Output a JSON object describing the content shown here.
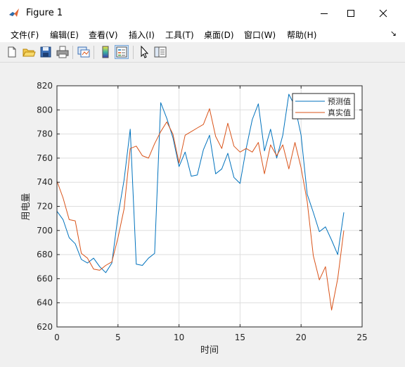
{
  "window": {
    "title": "Figure 1",
    "icon": "matlab-logo-icon",
    "controls": [
      "minimize-icon",
      "maximize-icon",
      "close-icon"
    ]
  },
  "menubar": {
    "items": [
      "文件(F)",
      "编辑(E)",
      "查看(V)",
      "插入(I)",
      "工具(T)",
      "桌面(D)",
      "窗口(W)",
      "帮助(H)"
    ],
    "dock_arrow": "↘"
  },
  "toolbar": {
    "buttons": [
      "new-figure-icon",
      "open-file-icon",
      "save-figure-icon",
      "print-figure-icon",
      "link-plot-icon",
      "insert-colorbar-icon",
      "insert-legend-icon",
      "edit-plot-icon",
      "property-inspector-icon"
    ]
  },
  "chart_data": {
    "type": "line",
    "title": "",
    "xlabel": "时间",
    "ylabel": "用电量",
    "xlim": [
      0,
      25
    ],
    "ylim": [
      620,
      820
    ],
    "xticks": [
      0,
      5,
      10,
      15,
      20,
      25
    ],
    "yticks": [
      620,
      640,
      660,
      680,
      700,
      720,
      740,
      760,
      780,
      800,
      820
    ],
    "grid": true,
    "legend_position": "top-right",
    "x": [
      0,
      0.5,
      1,
      1.5,
      2,
      2.5,
      3,
      3.5,
      4,
      4.5,
      5,
      5.5,
      6,
      6.5,
      7,
      7.5,
      8,
      8.5,
      9,
      9.5,
      10,
      10.5,
      11,
      11.5,
      12,
      12.5,
      13,
      13.5,
      14,
      14.5,
      15,
      15.5,
      16,
      16.5,
      17,
      17.5,
      18,
      18.5,
      19,
      19.5,
      20,
      20.5,
      21,
      21.5,
      22,
      22.5,
      23,
      23.5
    ],
    "series": [
      {
        "name": "预测值",
        "color": "#0072bd",
        "values": [
          716,
          709,
          694,
          689,
          676,
          673,
          677,
          670,
          665,
          673,
          712,
          742,
          784,
          672,
          671,
          677,
          681,
          806,
          793,
          777,
          753,
          765,
          745,
          746,
          767,
          779,
          747,
          751,
          764,
          744,
          739,
          768,
          792,
          805,
          766,
          784,
          760,
          779,
          813,
          803,
          779,
          730,
          715,
          699,
          703,
          692,
          680,
          715
        ]
      },
      {
        "name": "真实值",
        "color": "#d95319",
        "values": [
          741,
          727,
          709,
          708,
          681,
          677,
          668,
          667,
          671,
          674,
          694,
          718,
          768,
          770,
          762,
          760,
          772,
          782,
          790,
          780,
          756,
          779,
          782,
          785,
          788,
          801,
          778,
          768,
          789,
          770,
          765,
          768,
          765,
          773,
          747,
          771,
          762,
          771,
          751,
          773,
          752,
          724,
          679,
          659,
          670,
          634,
          660,
          700
        ]
      }
    ]
  }
}
